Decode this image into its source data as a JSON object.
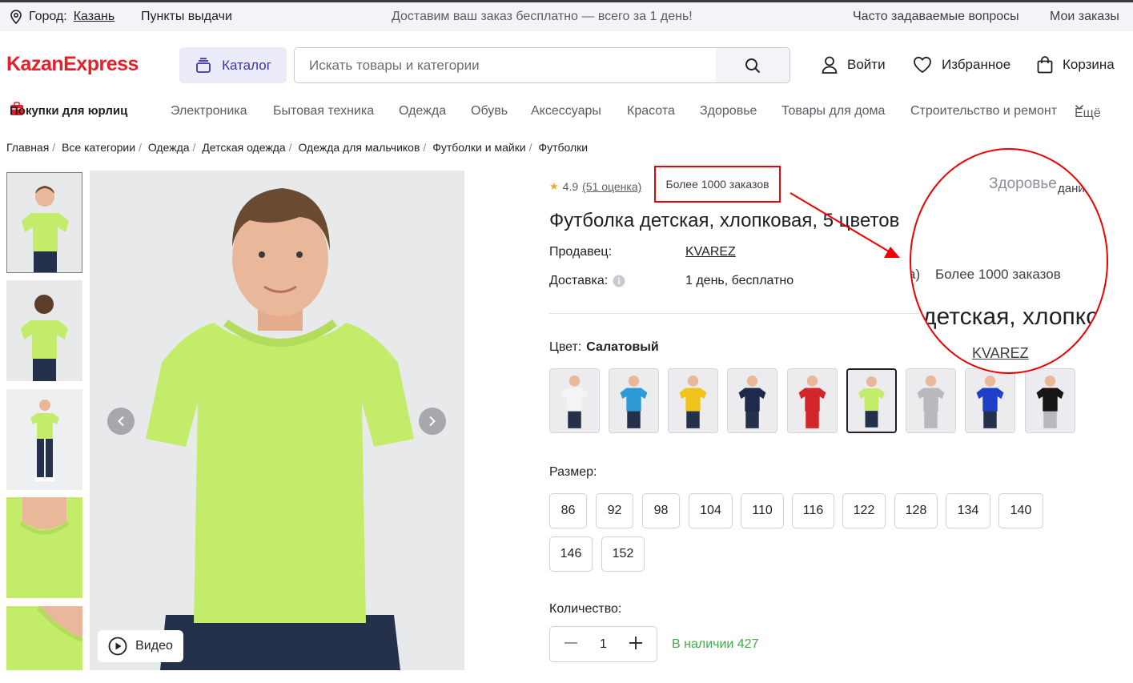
{
  "topbar": {
    "city_label": "Город:",
    "city_value": "Казань",
    "pickup": "Пункты выдачи",
    "promo": "Доставим ваш заказ бесплатно — всего за 1 день!",
    "faq": "Часто задаваемые вопросы",
    "orders": "Мои заказы"
  },
  "header": {
    "logo": "KazanExpress",
    "catalog_label": "Каталог",
    "search_placeholder": "Искать товары и категории",
    "login": "Войти",
    "favorites": "Избранное",
    "cart": "Корзина"
  },
  "category_nav": {
    "business": "Покупки для юрлиц",
    "items": [
      "Электроника",
      "Бытовая техника",
      "Одежда",
      "Обувь",
      "Аксессуары",
      "Красота",
      "Здоровье",
      "Товары для дома",
      "Строительство и ремонт"
    ],
    "more": "Ещё"
  },
  "breadcrumbs": [
    "Главная",
    "Все категории",
    "Одежда",
    "Детская одежда",
    "Одежда для мальчиков",
    "Футболки и майки",
    "Футболки"
  ],
  "product": {
    "rating": "4.9",
    "reviews": "(51 оценка)",
    "orders": "Более 1000 заказов",
    "title": "Футболка детская, хлопковая, 5 цветов",
    "seller_label": "Продавец:",
    "seller": "KVAREZ",
    "delivery_label": "Доставка:",
    "delivery": "1 день, бесплатно",
    "color_label": "Цвет:",
    "color_value": "Салатовый",
    "video_label": "Видео",
    "size_label": "Размер:",
    "sizes": [
      "86",
      "92",
      "98",
      "104",
      "110",
      "116",
      "122",
      "128",
      "134",
      "140",
      "146",
      "152"
    ],
    "qty_label": "Количество:",
    "qty_value": "1",
    "stock": "В наличии 427"
  },
  "zoom": {
    "top_fragment": "Здоровье",
    "top_fragment2": "дания",
    "orders_fragment_prefix": "а)",
    "orders_fragment": "Более 1000 заказов",
    "title_fragment": "детская, хлопко",
    "seller_fragment": "KVAREZ"
  },
  "colors": {
    "accent": "#e4212a",
    "catalog_bg": "#ebebfa",
    "catalog_text": "#3b35a8",
    "annotation": "#ee0000",
    "stock": "#3fae49",
    "shirt_selected": "#c4ec6b"
  },
  "swatch_colors": [
    "#f4f4f4",
    "#2f9bd6",
    "#f0c31a",
    "#1f2a4a",
    "#d3262a",
    "#c4ec6b",
    "#b8b9bc",
    "#1f3fc9",
    "#161616"
  ]
}
